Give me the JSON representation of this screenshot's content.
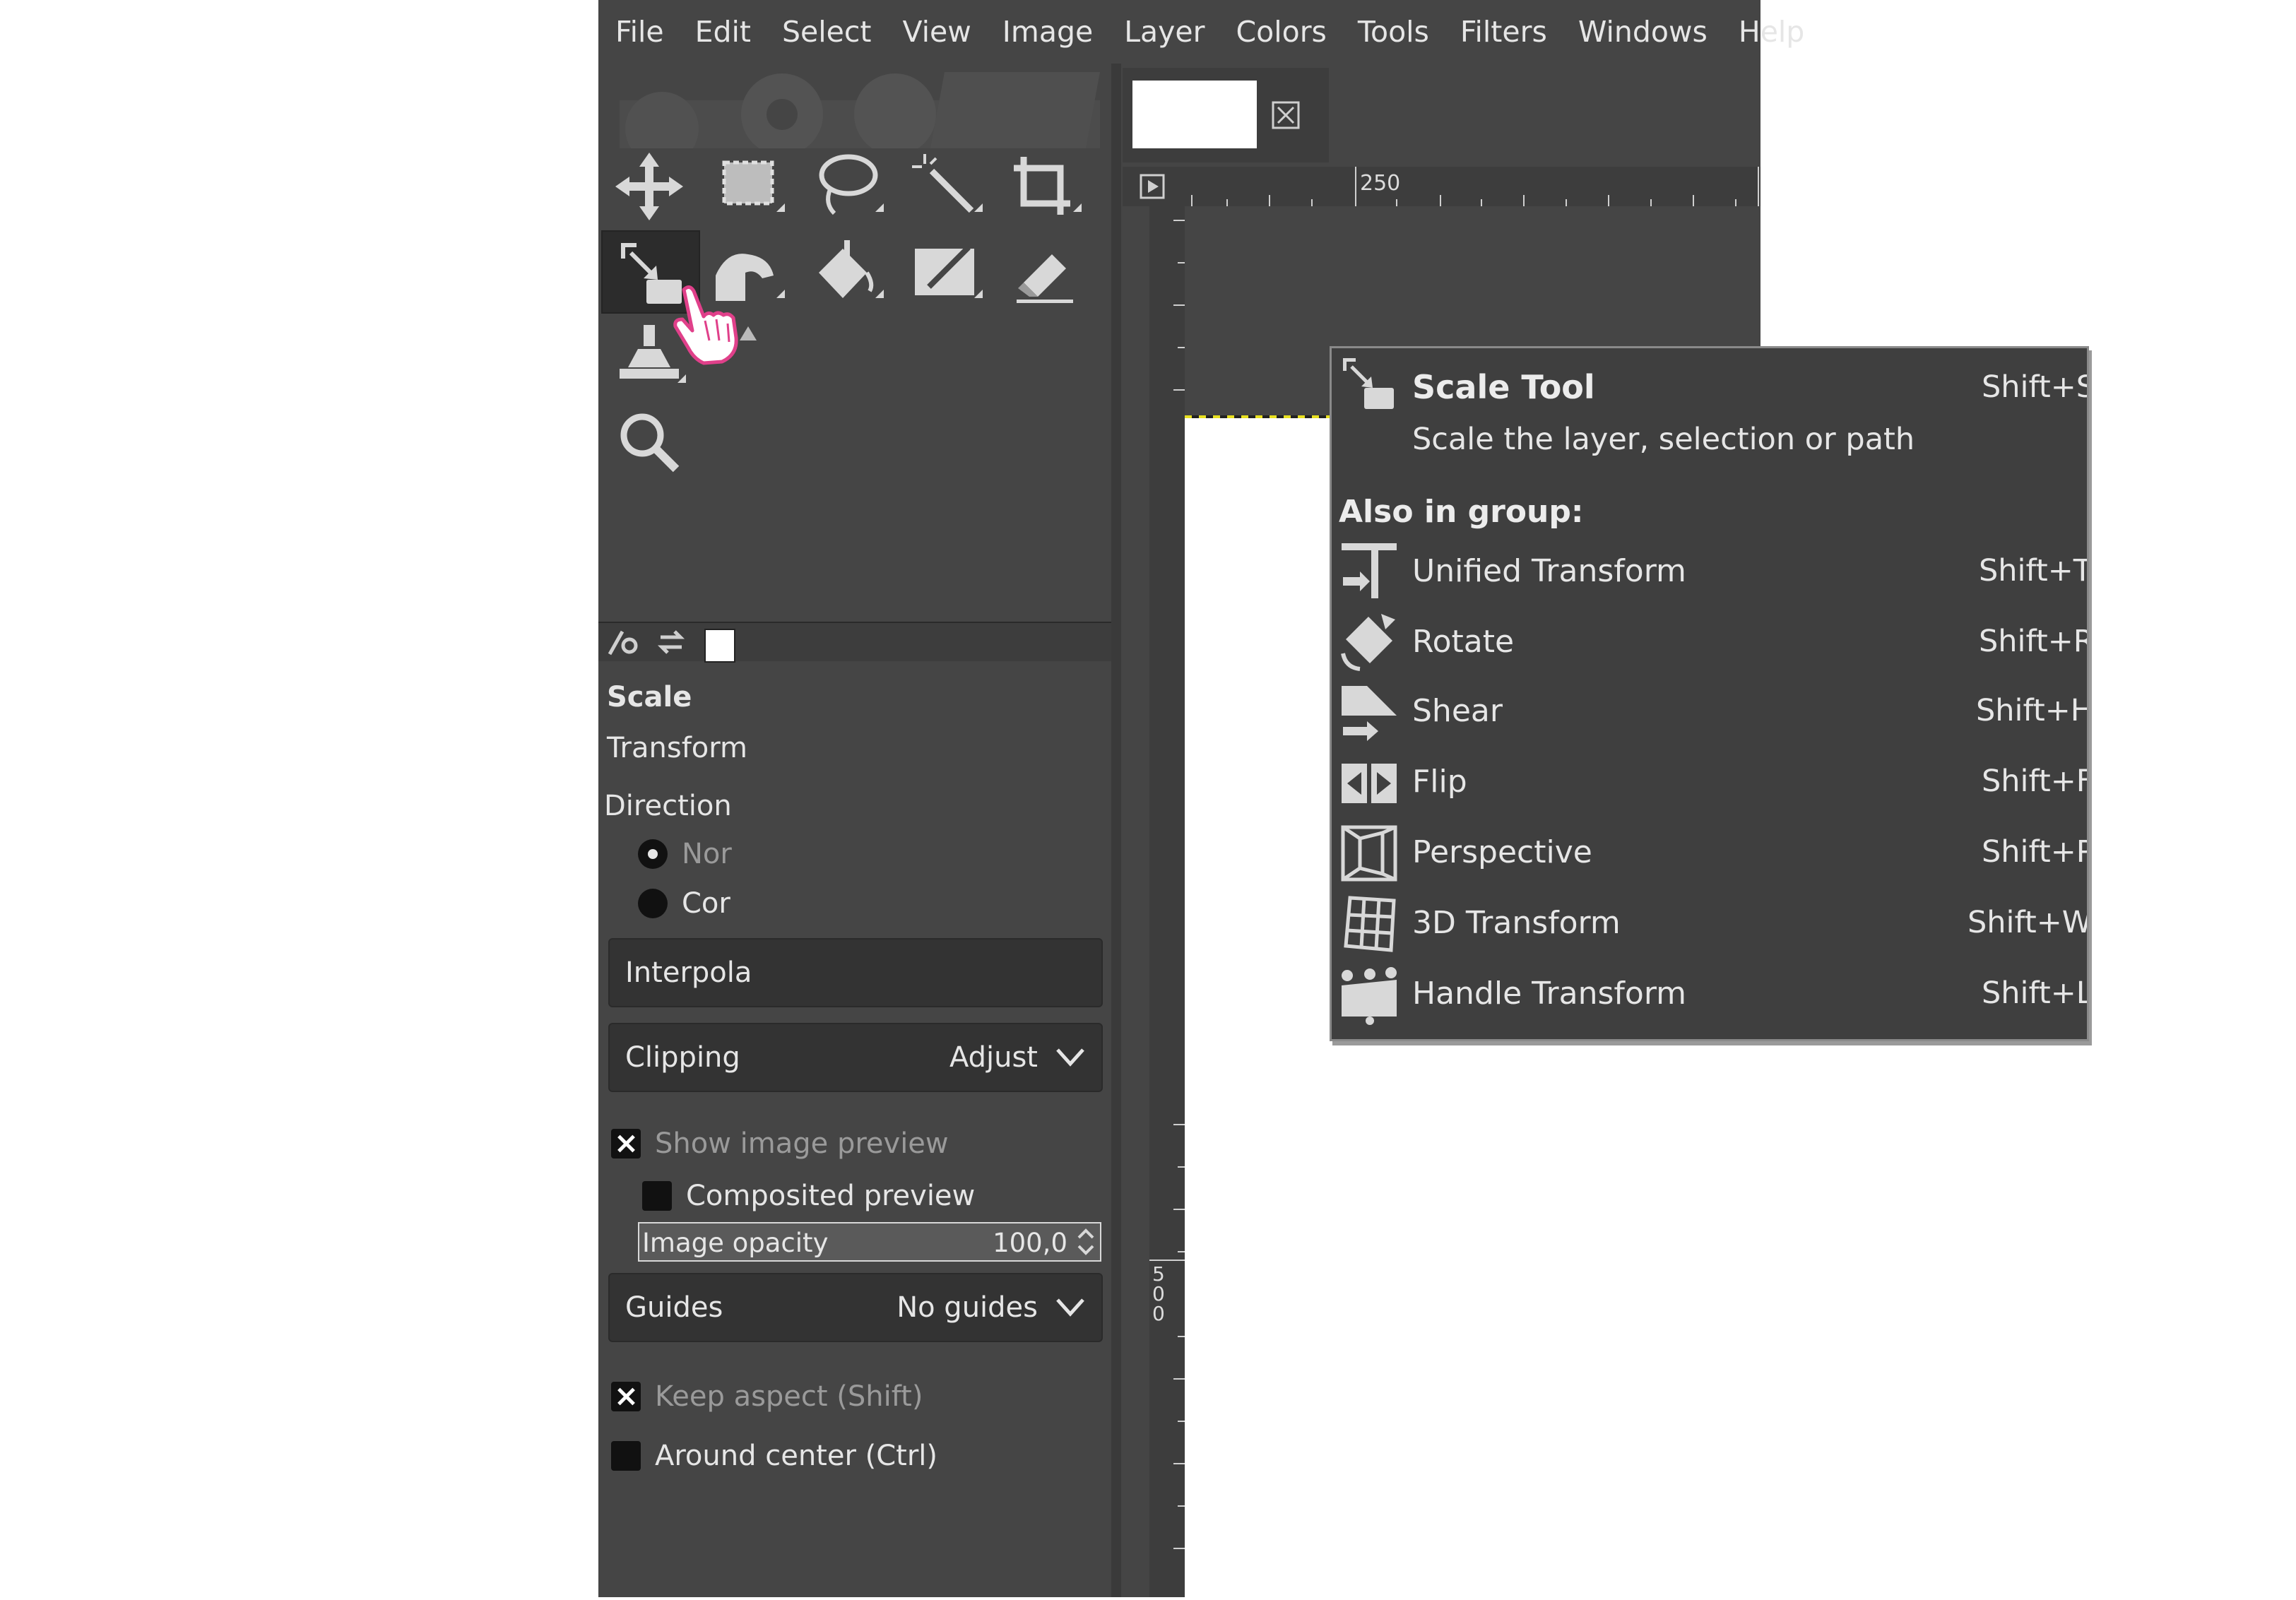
{
  "menubar": {
    "items": [
      "File",
      "Edit",
      "Select",
      "View",
      "Image",
      "Layer",
      "Colors",
      "Tools",
      "Filters",
      "Windows",
      "Help"
    ]
  },
  "toolbox": {
    "tools_row1": [
      "move-tool-icon",
      "rect-select-tool-icon",
      "lasso-tool-icon",
      "fuzzy-select-tool-icon",
      "crop-tool-icon"
    ],
    "tools_row2": [
      "scale-tool-icon",
      "warp-transform-tool-icon",
      "bucket-fill-tool-icon",
      "paintbrush-tool-icon",
      "eraser-tool-icon"
    ],
    "tools_row3": [
      "clone-tool-icon"
    ],
    "tools_row4": [
      "zoom-tool-icon"
    ]
  },
  "tool_options": {
    "title": "Scale",
    "transform_label": "Transform",
    "direction_label": "Direction",
    "direction_normal": "Nor",
    "direction_corrective": "Cor",
    "interpolation_label": "Interpola",
    "clipping_label": "Clipping",
    "clipping_value": "Adjust",
    "show_preview": "Show image preview",
    "show_preview_checked": true,
    "composited_preview": "Composited preview",
    "composited_checked": false,
    "image_opacity_label": "Image opacity",
    "image_opacity_value": "100,0",
    "image_opacity_fraction": 1.0,
    "guides_label": "Guides",
    "guides_value": "No guides",
    "keep_aspect": "Keep aspect (Shift)",
    "keep_aspect_checked": true,
    "around_center": "Around center (Ctrl)",
    "around_center_checked": false
  },
  "rulers": {
    "h_label": "250",
    "v_label": "500"
  },
  "tooltip": {
    "title": "Scale Tool",
    "title_shortcut": "Shift+S",
    "description": "Scale the layer, selection or path",
    "group_heading": "Also in group:",
    "items": [
      {
        "name": "Unified Transform",
        "shortcut": "Shift+T",
        "icon": "unified-transform-icon"
      },
      {
        "name": "Rotate",
        "shortcut": "Shift+R",
        "icon": "rotate-icon"
      },
      {
        "name": "Shear",
        "shortcut": "Shift+H",
        "icon": "shear-icon"
      },
      {
        "name": "Flip",
        "shortcut": "Shift+F",
        "icon": "flip-icon"
      },
      {
        "name": "Perspective",
        "shortcut": "Shift+P",
        "icon": "perspective-icon"
      },
      {
        "name": "3D Transform",
        "shortcut": "Shift+W",
        "icon": "3d-transform-icon"
      },
      {
        "name": "Handle Transform",
        "shortcut": "Shift+L",
        "icon": "handle-transform-icon"
      }
    ]
  },
  "colors": {
    "panel_bg": "#454545",
    "menu_text": "#e6e6e6",
    "selection_ants": "#e8e020",
    "cursor_accent": "#e0408a"
  }
}
